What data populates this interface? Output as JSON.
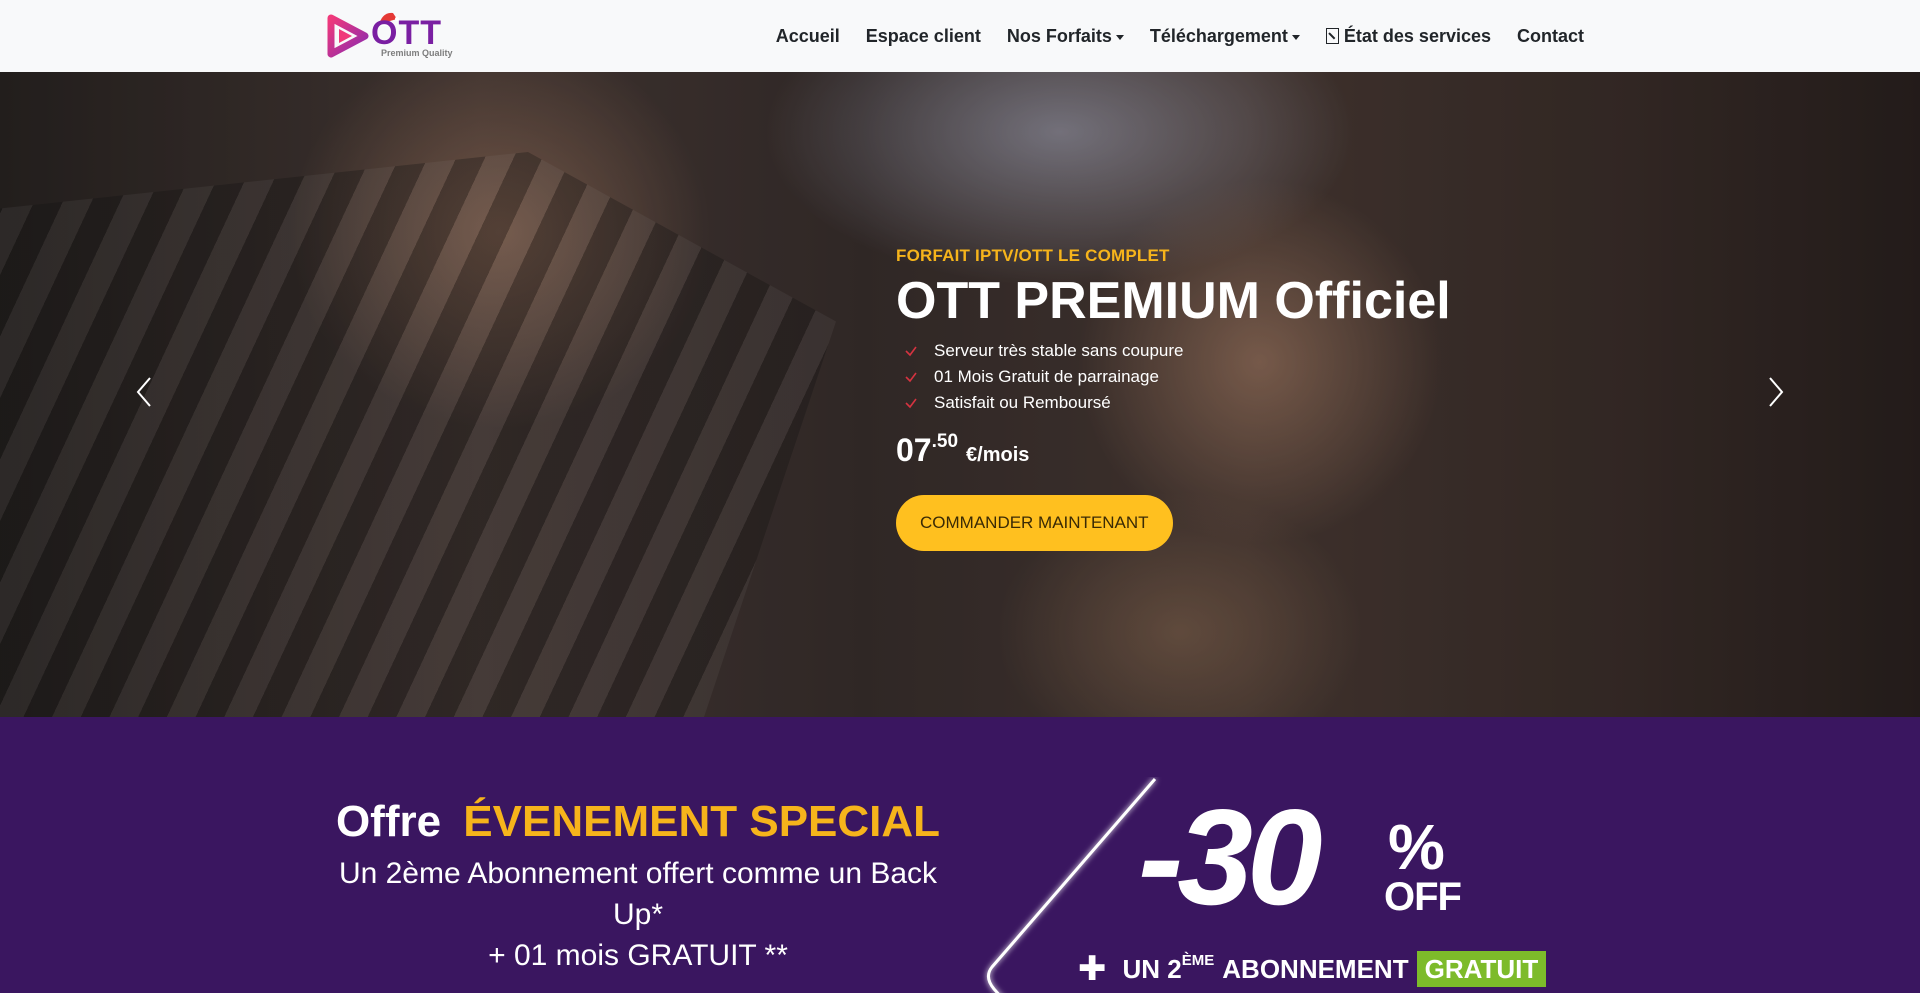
{
  "brand": {
    "logo_text": "OTT",
    "logo_tagline": "Premium Quality"
  },
  "nav": {
    "items": [
      {
        "label": "Accueil",
        "dropdown": false
      },
      {
        "label": "Espace client",
        "dropdown": false
      },
      {
        "label": "Nos Forfaits",
        "dropdown": true
      },
      {
        "label": "Téléchargement",
        "dropdown": true
      },
      {
        "label": "État des services",
        "dropdown": false,
        "icon": "status-icon"
      },
      {
        "label": "Contact",
        "dropdown": false
      }
    ]
  },
  "hero": {
    "eyebrow": "FORFAIT IPTV/OTT LE COMPLET",
    "title": "OTT PREMIUM Officiel",
    "features": [
      "Serveur très stable sans coupure",
      "01 Mois Gratuit de parrainage",
      "Satisfait ou Remboursé"
    ],
    "price_int": "07",
    "price_dec": ".50",
    "price_unit": "€/mois",
    "cta_label": "COMMANDER MAINTENANT",
    "prev_icon": "chevron-left-icon",
    "next_icon": "chevron-right-icon"
  },
  "promo": {
    "heading_prefix": "Offre",
    "heading_accent": "ÉVENEMENT SPECIAL",
    "line1": "Un 2ème Abonnement offert comme un Back Up*",
    "line2": "+ 01 mois GRATUIT **",
    "badge_value": "-30",
    "badge_pct": "%",
    "badge_off": "OFF",
    "badge_plus": "✚",
    "badge_text_a": "UN 2",
    "badge_text_sup": "ÈME",
    "badge_text_b": "ABONNEMENT",
    "badge_free": "GRATUIT"
  },
  "colors": {
    "accent": "#f6b41b",
    "cta": "#ffc01f",
    "promo_bg": "#3a1660",
    "free_tag": "#7dbb2a",
    "check": "#d63340"
  }
}
